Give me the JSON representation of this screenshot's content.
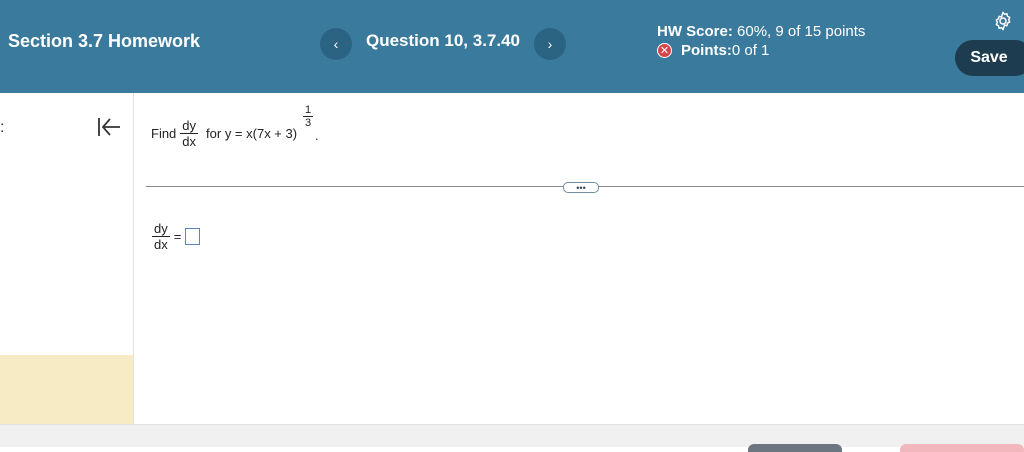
{
  "header": {
    "section_title": "Section 3.7 Homework",
    "prev_icon": "chevron-left-icon",
    "prev_glyph": "‹",
    "question_label": "Question 10, 3.7.40",
    "next_icon": "chevron-right-icon",
    "next_glyph": "›",
    "hw_score_label": "HW Score:",
    "hw_score_value": " 60%, 9 of 15 points",
    "points_label": "Points:",
    "points_value": " 0 of 1",
    "incorrect_glyph": "✕",
    "settings_icon": "gear-icon",
    "save_label": "Save"
  },
  "colors": {
    "header_bg": "#3a7a9c",
    "save_bg": "#1e3c4f",
    "incorrect": "#d6454a",
    "highlight": "#f7ebc6",
    "answer_border": "#5b84c4"
  },
  "left_panel": {
    "collapse_icon": "collapse-left-icon",
    "edge_mark": ":"
  },
  "question": {
    "find": "Find",
    "deriv_num": "dy",
    "deriv_den": "dx",
    "for_text": "for y = x(7x + 3)",
    "exp_num": "1",
    "exp_den": "3",
    "period": "."
  },
  "divider": {
    "more_label": "•••"
  },
  "answer": {
    "lhs_num": "dy",
    "lhs_den": "dx",
    "equals": "=",
    "value": ""
  }
}
